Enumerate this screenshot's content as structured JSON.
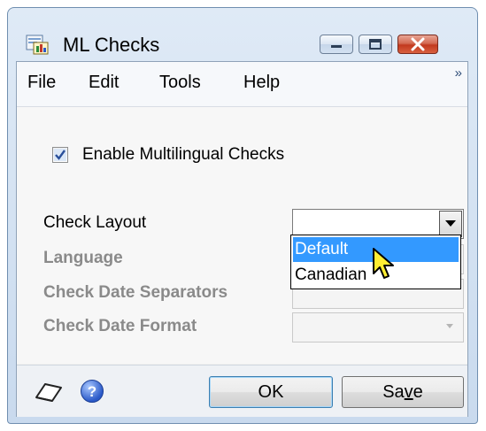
{
  "window": {
    "title": "ML  Checks"
  },
  "menu": {
    "items": [
      "File",
      "Edit",
      "Tools",
      "Help"
    ],
    "overflow": "»"
  },
  "form": {
    "enable_checkbox": {
      "label": "Enable Multilingual Checks",
      "checked": true
    },
    "check_layout": {
      "label": "Check Layout",
      "value": ""
    },
    "language": {
      "label": "Language"
    },
    "separators": {
      "label": "Check Date Separators"
    },
    "date_format": {
      "label": "Check Date Format"
    },
    "dropdown_options": [
      "Default",
      "Canadian"
    ],
    "highlighted_option": "Default"
  },
  "buttons": {
    "ok": "OK",
    "save": "Save"
  },
  "colors": {
    "highlight": "#3399ff",
    "disabled_text": "#8a8a8a"
  },
  "icons": [
    "application-icon",
    "minimize-icon",
    "maximize-icon",
    "close-icon",
    "checkmark-icon",
    "dropdown-arrow-icon",
    "note-icon",
    "help-icon",
    "mouse-cursor-icon"
  ]
}
